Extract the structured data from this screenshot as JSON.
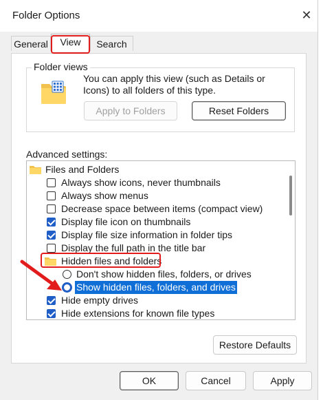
{
  "window": {
    "title": "Folder Options",
    "close_glyph": "✕"
  },
  "tabs": [
    {
      "label": "General",
      "active": false
    },
    {
      "label": "View",
      "active": true
    },
    {
      "label": "Search",
      "active": false
    }
  ],
  "folder_views": {
    "legend": "Folder views",
    "description": "You can apply this view (such as Details or Icons) to all folders of this type.",
    "apply_label": "Apply to Folders",
    "reset_label": "Reset Folders",
    "icon": "folder-view-icon"
  },
  "advanced": {
    "label": "Advanced settings:",
    "items": [
      {
        "kind": "folder",
        "label": "Files and Folders"
      },
      {
        "kind": "checkbox",
        "label": "Always show icons, never thumbnails",
        "checked": false
      },
      {
        "kind": "checkbox",
        "label": "Always show menus",
        "checked": false
      },
      {
        "kind": "checkbox",
        "label": "Decrease space between items (compact view)",
        "checked": false
      },
      {
        "kind": "checkbox",
        "label": "Display file icon on thumbnails",
        "checked": true
      },
      {
        "kind": "checkbox",
        "label": "Display file size information in folder tips",
        "checked": true
      },
      {
        "kind": "checkbox",
        "label": "Display the full path in the title bar",
        "checked": false
      },
      {
        "kind": "folder",
        "label": "Hidden files and folders"
      },
      {
        "kind": "radio",
        "label": "Don't show hidden files, folders, or drives",
        "checked": false
      },
      {
        "kind": "radio",
        "label": "Show hidden files, folders, and drives",
        "checked": true
      },
      {
        "kind": "checkbox",
        "label": "Hide empty drives",
        "checked": true
      },
      {
        "kind": "checkbox",
        "label": "Hide extensions for known file types",
        "checked": true
      }
    ]
  },
  "restore_label": "Restore Defaults",
  "footer": {
    "ok": "OK",
    "cancel": "Cancel",
    "apply": "Apply"
  },
  "colors": {
    "accent": "#1f5ec7",
    "selection": "#0f6fd6",
    "annotation": "#e21c1c"
  }
}
